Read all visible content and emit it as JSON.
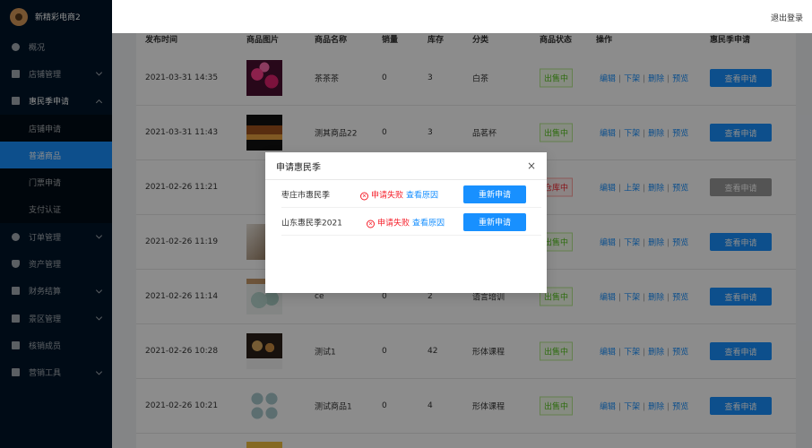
{
  "app": {
    "name": "新精彩电商2",
    "logout": "退出登录"
  },
  "sidebar": {
    "items": [
      {
        "label": "概况",
        "icon": "dashboard-icon"
      },
      {
        "label": "店铺管理",
        "icon": "shop-icon"
      },
      {
        "label": "惠民季申请",
        "icon": "apply-icon"
      },
      {
        "label": "订单管理",
        "icon": "order-icon"
      },
      {
        "label": "资产管理",
        "icon": "asset-icon"
      },
      {
        "label": "财务结算",
        "icon": "finance-icon"
      },
      {
        "label": "景区管理",
        "icon": "scenic-icon"
      },
      {
        "label": "核销成员",
        "icon": "member-icon"
      },
      {
        "label": "营销工具",
        "icon": "marketing-icon"
      }
    ],
    "sub_items": [
      "店铺申请",
      "普通商品",
      "门票申请",
      "支付认证"
    ]
  },
  "table": {
    "headers": [
      "发布时间",
      "商品图片",
      "商品名称",
      "销量",
      "库存",
      "分类",
      "商品状态",
      "操作",
      "惠民季申请"
    ],
    "op_labels": {
      "edit": "编辑",
      "down": "下架",
      "up": "上架",
      "delete": "删除",
      "preview": "预览"
    },
    "rows": [
      {
        "time": "2021-03-31 14:35",
        "name": "茶茶茶",
        "sales": "0",
        "stock": "3",
        "category": "白茶",
        "status": "出售中",
        "toggle": "下架",
        "action": "查看申请"
      },
      {
        "time": "2021-03-31 11:43",
        "name": "测其商品22",
        "sales": "0",
        "stock": "3",
        "category": "品茗杯",
        "status": "出售中",
        "toggle": "下架",
        "action": "查看申请"
      },
      {
        "time": "2021-02-26 11:21",
        "name": "",
        "sales": "",
        "stock": "",
        "category": "",
        "status": "仓库中",
        "toggle": "上架",
        "action": "查看申请"
      },
      {
        "time": "2021-02-26 11:19",
        "name": "",
        "sales": "",
        "stock": "",
        "category": "",
        "status": "出售中",
        "toggle": "下架",
        "action": "查看申请"
      },
      {
        "time": "2021-02-26 11:14",
        "name": "ce",
        "sales": "0",
        "stock": "2",
        "category": "语言培训",
        "status": "出售中",
        "toggle": "下架",
        "action": "查看申请"
      },
      {
        "time": "2021-02-26 10:28",
        "name": "测试1",
        "sales": "0",
        "stock": "42",
        "category": "形体课程",
        "status": "出售中",
        "toggle": "下架",
        "action": "查看申请"
      },
      {
        "time": "2021-02-26 10:21",
        "name": "测试商品1",
        "sales": "0",
        "stock": "4",
        "category": "形体课程",
        "status": "出售中",
        "toggle": "下架",
        "action": "查看申请"
      }
    ]
  },
  "modal": {
    "title": "申请惠民季",
    "close": "×",
    "fail_label": "申请失败",
    "reason_label": "查看原因",
    "reapply_label": "重新申请",
    "fail_icon": "⊗",
    "rows": [
      {
        "name": "枣庄市惠民季"
      },
      {
        "name": "山东惠民季2021"
      }
    ]
  },
  "colors": {
    "primary": "#1890ff",
    "sidebar": "#001529",
    "danger": "#f5222d",
    "success": "#52c41a"
  }
}
